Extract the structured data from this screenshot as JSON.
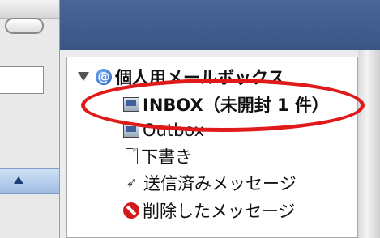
{
  "mailboxes": {
    "account_label": "個人用メールボックス",
    "items": [
      {
        "label": "INBOX（未開封 1 件）",
        "icon": "inbox-tray-icon"
      },
      {
        "label": "Outbox",
        "icon": "outbox-tray-icon"
      },
      {
        "label": "下書き",
        "icon": "document-icon"
      },
      {
        "label": "送信済みメッセージ",
        "icon": "paper-plane-icon"
      },
      {
        "label": "削除したメッセージ",
        "icon": "trash-icon"
      }
    ]
  },
  "colors": {
    "highlight": "#e01a1a",
    "titlebar": "#3a5585",
    "scrollbar": "#9fbde2"
  }
}
